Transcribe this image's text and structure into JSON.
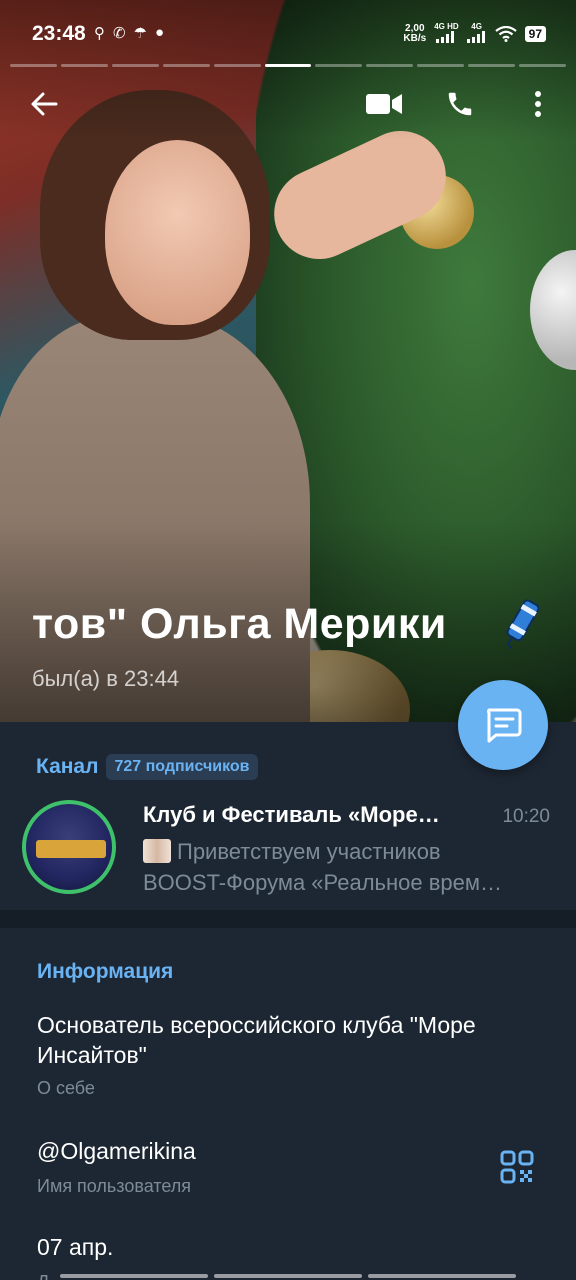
{
  "status_bar": {
    "time": "23:48",
    "icons": [
      "search-icon",
      "whatsapp-icon",
      "umbrella-icon",
      "chat-icon"
    ],
    "net_speed_value": "2,00",
    "net_speed_unit": "KB/s",
    "sim1": "4G HD",
    "sim2": "4G",
    "battery": "97"
  },
  "story": {
    "segments_total": 11,
    "active_segment": 6
  },
  "profile": {
    "name": "тов\"   Ольга Мерики",
    "last_seen": "был(а) в 23:44"
  },
  "channel": {
    "label": "Канал",
    "subscribers": "727 подписчиков",
    "title": "Клуб и Фестиваль «Море…",
    "time": "10:20",
    "preview_line1": "Приветствуем участников",
    "preview_line2": "BOOST-Форума «Реальное врем…"
  },
  "info": {
    "heading": "Информация",
    "bio": "Основатель всероссийского клуба \"Море Инсайтов\"",
    "bio_label": "О себе",
    "username": "@Olgamerikina",
    "username_label": "Имя пользователя",
    "birthday": "07 апр.",
    "birthday_label": "Д"
  },
  "colors": {
    "accent": "#6ab3f3",
    "background": "#1d2733",
    "secondary_text": "#7d8b99",
    "online_ring": "#3fc06a"
  }
}
